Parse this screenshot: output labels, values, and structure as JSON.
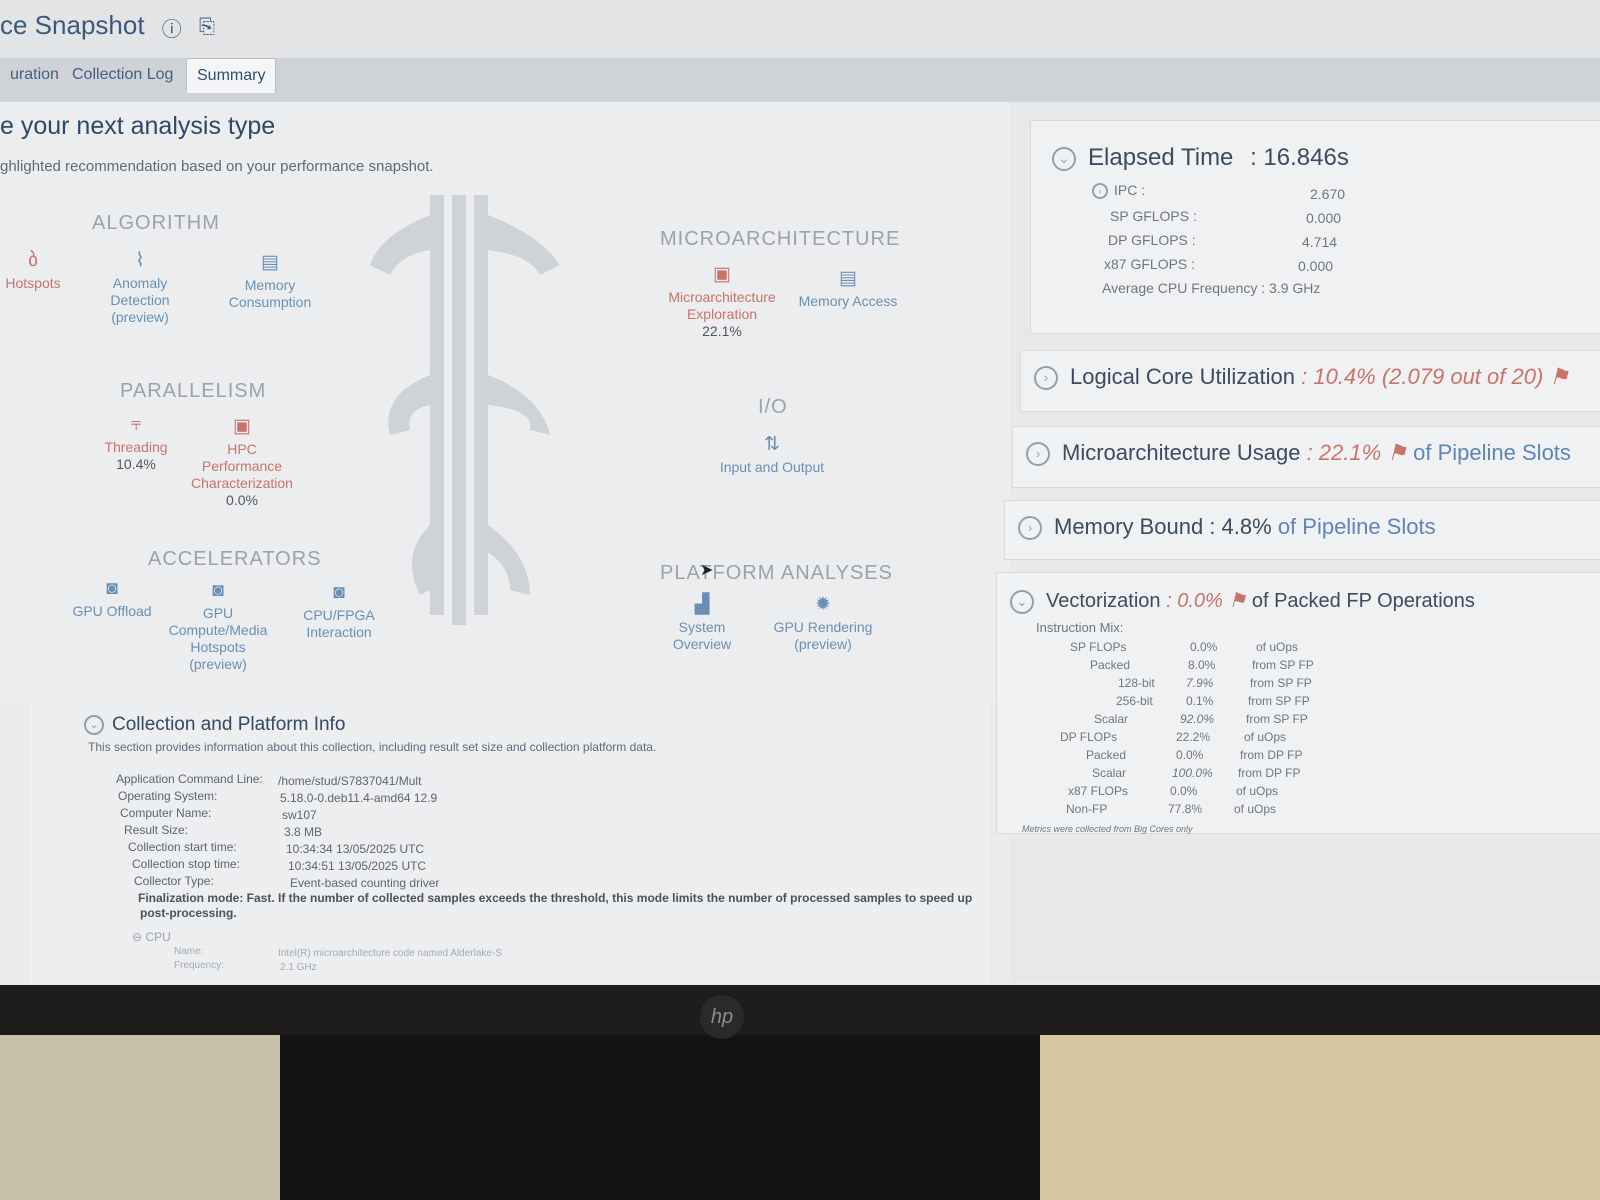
{
  "window": {
    "title": "ce Snapshot",
    "help_icon": "question-circle-icon",
    "pin_icon": "pin-icon"
  },
  "tabs": [
    {
      "label": "uration",
      "active": false
    },
    {
      "label": "Collection Log",
      "active": false
    },
    {
      "label": "Summary",
      "active": true
    }
  ],
  "main": {
    "heading": "e your next analysis type",
    "subheading": "ghlighted recommendation based on your performance snapshot.",
    "sections": {
      "algorithm": "ALGORITHM",
      "parallelism": "PARALLELISM",
      "accelerators": "ACCELERATORS",
      "microarchitecture": "MICROARCHITECTURE",
      "io": "I/O",
      "platform": "PLATFORM ANALYSES"
    },
    "items": {
      "hotspots": {
        "label": "Hotspots",
        "icon": "flame-icon"
      },
      "anomaly": {
        "label1": "Anomaly",
        "label2": "Detection",
        "label3": "(preview)",
        "icon": "pulse-icon"
      },
      "memory_consumption": {
        "label1": "Memory",
        "label2": "Consumption",
        "icon": "memory-icon"
      },
      "threading": {
        "label": "Threading",
        "value": "10.4%",
        "icon": "threading-icon"
      },
      "hpc": {
        "label1": "HPC",
        "label2": "Performance",
        "label3": "Characterization",
        "value": "0.0%",
        "icon": "chip-icon"
      },
      "gpu_offload": {
        "label": "GPU Offload",
        "icon": "gpu-icon"
      },
      "gpu_compute": {
        "label1": "GPU",
        "label2": "Compute/Media",
        "label3": "Hotspots",
        "label4": "(preview)",
        "icon": "gpu-icon"
      },
      "cpu_fpga": {
        "label1": "CPU/FPGA",
        "label2": "Interaction",
        "icon": "fpga-icon"
      },
      "micro_exploration": {
        "label1": "Microarchitecture",
        "label2": "Exploration",
        "value": "22.1%",
        "icon": "chip-icon"
      },
      "memory_access": {
        "label": "Memory Access",
        "icon": "memory-icon"
      },
      "io": {
        "label": "Input and Output",
        "icon": "io-arrows-icon"
      },
      "system_overview": {
        "label1": "System",
        "label2": "Overview",
        "icon": "bar-chart-icon"
      },
      "gpu_rendering": {
        "label1": "GPU Rendering",
        "label2": "(preview)",
        "icon": "gear-icon"
      }
    }
  },
  "elapsed": {
    "label": "Elapsed Time",
    "value": ": 16.846s",
    "rows": [
      {
        "label": "IPC",
        "sep": ":",
        "value": "2.670"
      },
      {
        "label": "SP GFLOPS",
        "sep": ":",
        "value": "0.000"
      },
      {
        "label": "DP GFLOPS",
        "sep": ":",
        "value": "4.714"
      },
      {
        "label": "x87 GFLOPS",
        "sep": ":",
        "value": "0.000"
      },
      {
        "label": "Average CPU Frequency",
        "sep": ":",
        "value": "3.9 GHz"
      }
    ]
  },
  "logical_core": {
    "label": "Logical Core Utilization",
    "value": ": 10.4% (2.079 out of 20)"
  },
  "micro_usage": {
    "label": "Microarchitecture Usage",
    "value": ": 22.1%",
    "suffix": "of Pipeline Slots"
  },
  "memory_bound": {
    "label": "Memory Bound",
    "value": ": 4.8%",
    "suffix": "of Pipeline Slots"
  },
  "vectorization": {
    "label": "Vectorization",
    "value": ": 0.0%",
    "suffix": "of Packed FP Operations",
    "instruction_mix": "Instruction Mix:",
    "rows": [
      {
        "label": "SP FLOPs",
        "value": "0.0%",
        "unit": "of uOps"
      },
      {
        "label": "Packed",
        "value": "8.0%",
        "unit": "from SP FP"
      },
      {
        "label": "128-bit",
        "value": "7.9%",
        "unit": "from SP FP"
      },
      {
        "label": "256-bit",
        "value": "0.1%",
        "unit": "from SP FP"
      },
      {
        "label": "Scalar",
        "value": "92.0%",
        "unit": "from SP FP"
      },
      {
        "label": "DP FLOPs",
        "value": "22.2%",
        "unit": "of uOps"
      },
      {
        "label": "Packed",
        "value": "0.0%",
        "unit": "from DP FP"
      },
      {
        "label": "Scalar",
        "value": "100.0%",
        "unit": "from DP FP"
      },
      {
        "label": "x87 FLOPs",
        "value": "0.0%",
        "unit": "of uOps"
      },
      {
        "label": "Non-FP",
        "value": "77.8%",
        "unit": "of uOps"
      }
    ],
    "footnote": "Metrics were collected from Big Cores only"
  },
  "collection": {
    "title": "Collection and Platform Info",
    "description": "This section provides information about this collection, including result set size and collection platform data.",
    "fields": [
      {
        "k": "Application Command Line:",
        "v": "/home/stud/S7837041/Mult"
      },
      {
        "k": "Operating System:",
        "v": "5.18.0-0.deb11.4-amd64 12.9"
      },
      {
        "k": "Computer Name:",
        "v": "sw107"
      },
      {
        "k": "Result Size:",
        "v": "3.8 MB"
      },
      {
        "k": "Collection start time:",
        "v": "10:34:34 13/05/2025 UTC"
      },
      {
        "k": "Collection stop time:",
        "v": "10:34:51 13/05/2025 UTC"
      },
      {
        "k": "Collector Type:",
        "v": "Event-based counting driver"
      }
    ],
    "finalization": "Finalization mode: Fast. If the number of collected samples exceeds the threshold, this mode limits the number of processed samples to speed up",
    "finalization2": "post-processing.",
    "cpu_label": "CPU",
    "cpu_name_k": "Name:",
    "cpu_name_v": "Intel(R) microarchitecture code named Alderlake-S",
    "cpu_freq_k": "Frequency:",
    "cpu_freq_v": "2.1 GHz"
  },
  "monitor": {
    "brand": "hp"
  }
}
